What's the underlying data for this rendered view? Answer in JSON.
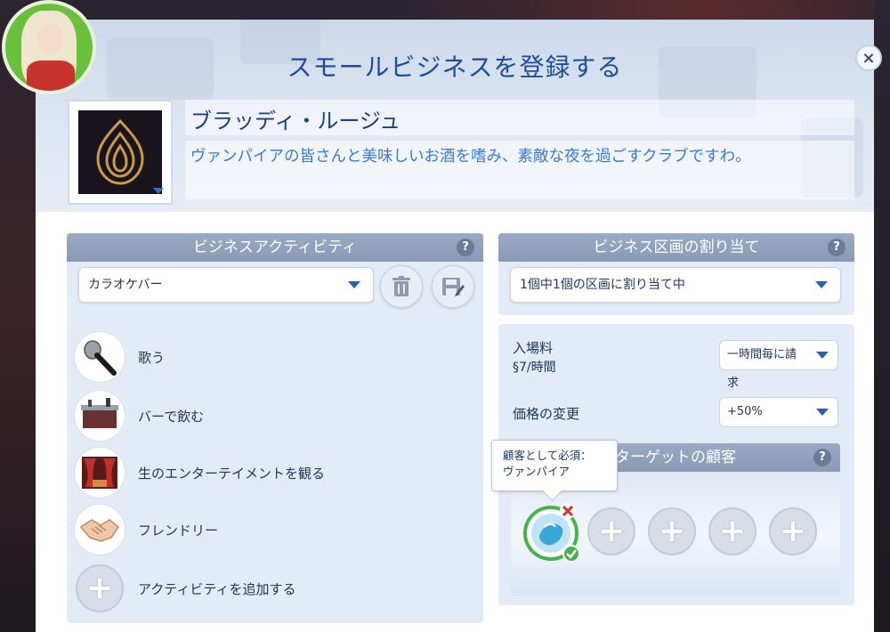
{
  "dialog": {
    "title": "スモールビジネスを登録する",
    "close_label": "×"
  },
  "business": {
    "name": "ブラッディ・ルージュ",
    "description": "ヴァンパイアの皆さんと美味しいお酒を嗜み、素敵な夜を過ごすクラブですわ。"
  },
  "activities_panel": {
    "header": "ビジネスアクティビティ",
    "help": "?",
    "preset_selected": "カラオケバー",
    "items": [
      {
        "label": "歌う",
        "icon": "microphone-icon"
      },
      {
        "label": "バーで飲む",
        "icon": "bar-counter-icon"
      },
      {
        "label": "生のエンターテイメントを観る",
        "icon": "stage-curtain-icon"
      },
      {
        "label": "フレンドリー",
        "icon": "handshake-icon"
      }
    ],
    "add_label": "アクティビティを追加する",
    "add_symbol": "+"
  },
  "lot_panel": {
    "header": "ビジネス区画の割り当て",
    "help": "?",
    "selected": "1個中1個の区画に割り当て中"
  },
  "pricing": {
    "entry_fee_label": "入場料",
    "entry_fee_value": "§7/時間",
    "billing_selected": "一時間毎に請求",
    "price_change_label": "価格の変更",
    "price_change_selected": "+50%"
  },
  "target_customers": {
    "header": "ターゲットの顧客",
    "help": "?",
    "add_symbol": "+",
    "slots_empty": 4,
    "tooltip_line1": "顧客として必須：",
    "tooltip_line2": "ヴァンパイア"
  },
  "colors": {
    "title_blue": "#1b4d9c",
    "accent_blue": "#3b7ad6",
    "panel_bg": "#e3ebf6",
    "header_gray": "#8a9ab6",
    "success_green": "#46b34a",
    "remove_red": "#d9302b"
  }
}
